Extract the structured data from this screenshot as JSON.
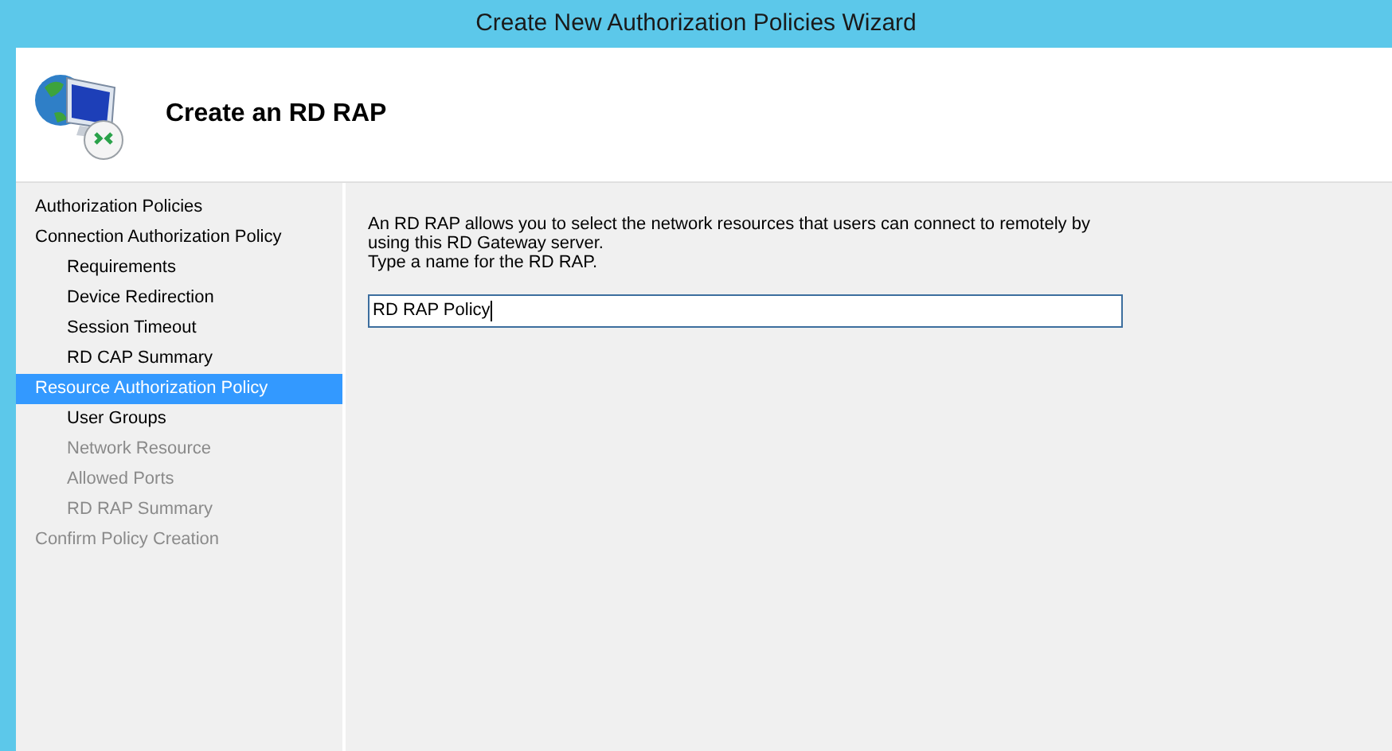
{
  "window": {
    "title": "Create New Authorization Policies Wizard"
  },
  "header": {
    "title": "Create an RD RAP"
  },
  "steps": [
    {
      "label": "Authorization Policies",
      "selected": false,
      "disabled": false
    },
    {
      "label": "Connection Authorization Policy",
      "selected": false,
      "disabled": false,
      "children": [
        {
          "label": "Requirements",
          "selected": false,
          "disabled": false
        },
        {
          "label": "Device Redirection",
          "selected": false,
          "disabled": false
        },
        {
          "label": "Session Timeout",
          "selected": false,
          "disabled": false
        },
        {
          "label": "RD CAP Summary",
          "selected": false,
          "disabled": false
        }
      ]
    },
    {
      "label": "Resource Authorization Policy",
      "selected": true,
      "disabled": false,
      "children": [
        {
          "label": "User Groups",
          "selected": false,
          "disabled": false
        },
        {
          "label": "Network Resource",
          "selected": false,
          "disabled": true
        },
        {
          "label": "Allowed Ports",
          "selected": false,
          "disabled": true
        },
        {
          "label": "RD RAP Summary",
          "selected": false,
          "disabled": true
        }
      ]
    },
    {
      "label": "Confirm Policy Creation",
      "selected": false,
      "disabled": true
    }
  ],
  "content": {
    "description": "An RD RAP allows you to select the network resources that users can connect to remotely by using this RD Gateway server.",
    "field_label": "Type a name for the RD RAP.",
    "name_field": {
      "value": "RD RAP Policy"
    }
  }
}
